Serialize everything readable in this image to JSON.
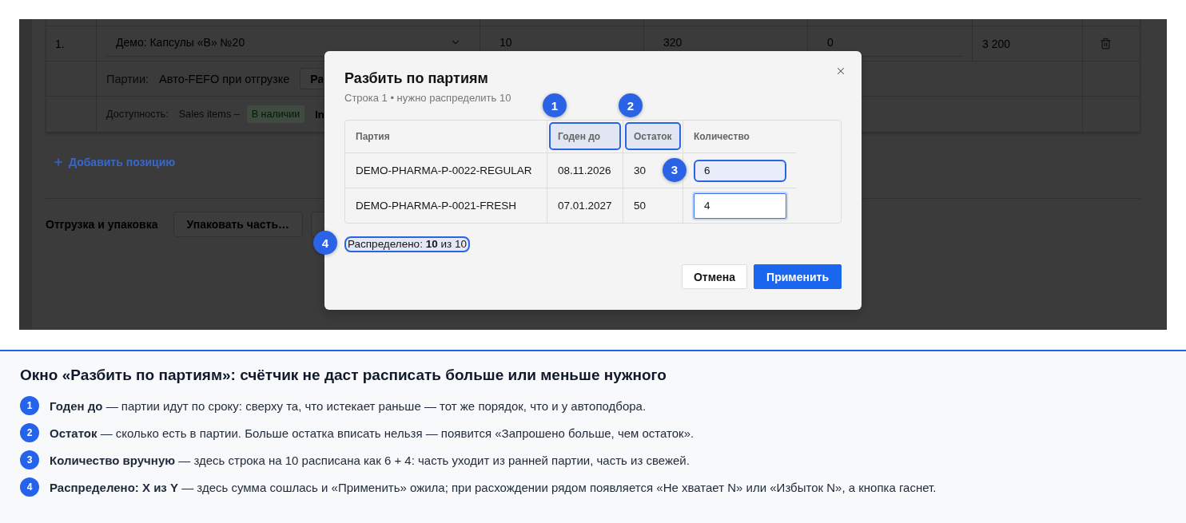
{
  "order": {
    "row": {
      "number": "1.",
      "product": "Демо: Капсулы «В» №20",
      "column_3": "10",
      "column_4": "320",
      "column_5": "0",
      "column_6": "3 200"
    },
    "batches": {
      "label": "Партии:",
      "value": "Авто-FEFO при отгрузке",
      "button": "Ра"
    },
    "availability": {
      "label": "Доступность:",
      "source": "Sales items –",
      "badge": "В наличии",
      "more": "In"
    }
  },
  "add_item_link": "Добавить позицию",
  "shipping": {
    "title": "Отгрузка и упаковка",
    "buttons": [
      {
        "kind": "full",
        "label": "Упаковать часть…"
      },
      {
        "kind": "cut"
      }
    ]
  },
  "dialog": {
    "title": "Разбить по партиям",
    "subtitle": "Строка 1 • нужно распределить 10",
    "columns": [
      {
        "label": "Партия",
        "highlighted": false
      },
      {
        "label": "Годен до",
        "highlighted": true,
        "callout": "1"
      },
      {
        "label": "Остаток",
        "highlighted": true,
        "callout": "2"
      },
      {
        "label": "Количество",
        "highlighted": false
      }
    ],
    "rows": [
      {
        "batch": "DEMO-PHARMA-P-0022-REGULAR",
        "expires": "08.11.2026",
        "stock": "30",
        "quantity": {
          "value": "6",
          "highlighted": true,
          "focused": false,
          "callout": "3"
        }
      },
      {
        "batch": "DEMO-PHARMA-P-0021-FRESH",
        "expires": "07.01.2027",
        "stock": "50",
        "quantity": {
          "value": "4",
          "highlighted": false,
          "focused": true
        }
      }
    ],
    "summary": {
      "text": "Распределено: **10** из 10",
      "highlighted": true,
      "callout": "4"
    },
    "buttons": [
      {
        "kind": "secondary",
        "label": "Отмена"
      },
      {
        "kind": "primary",
        "label": "Применить"
      }
    ]
  },
  "notes": {
    "title": "Окно «Разбить по партиям»: счётчик не даст расписать больше или меньше нужного",
    "items": [
      {
        "number": "1",
        "text": "**Годен до** — партии идут по сроку: сверху та, что истекает раньше — тот же порядок, что и у автоподбора."
      },
      {
        "number": "2",
        "text": "**Остаток** — сколько есть в партии. Больше остатка вписать нельзя — появится «Запрошено больше, чем остаток»."
      },
      {
        "number": "3",
        "text": "**Количество вручную** — здесь строка на 10 расписана как 6 + 4: часть уходит из ранней партии, часть из свежей."
      },
      {
        "number": "4",
        "text": "**Распределено: X из Y** — здесь сумма сошлась и «Применить» ожила; при расхождении рядом появляется «Не хватает N» или «Избыток N», а кнопка гаснет."
      }
    ]
  }
}
